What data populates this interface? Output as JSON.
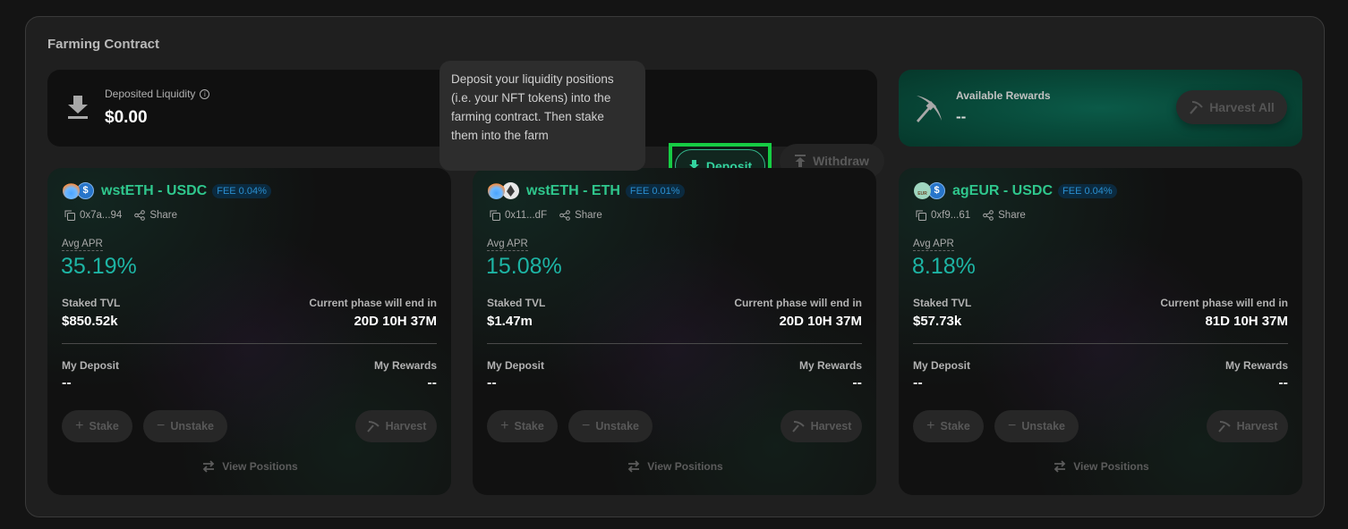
{
  "panel": {
    "title": "Farming Contract"
  },
  "liquidity": {
    "label": "Deposited Liquidity",
    "value": "$0.00",
    "icon": "download-icon",
    "info_icon": "info-icon"
  },
  "tooltip": {
    "text": "Deposit your liquidity positions (i.e. your NFT tokens) into the farming contract. Then stake them into the farm"
  },
  "actions": {
    "deposit_label": "Deposit",
    "withdraw_label": "Withdraw"
  },
  "rewards": {
    "label": "Available Rewards",
    "value": "--",
    "harvest_all_label": "Harvest All",
    "icon": "pickaxe-icon"
  },
  "colors": {
    "accent_green": "#2fc78d",
    "apr_teal": "#1db4a4",
    "fee_blue": "#2a8fd0",
    "highlight_border": "#16cc44"
  },
  "farms": [
    {
      "pair": "wstETH - USDC",
      "token_a": "wstETH",
      "token_b": "USDC",
      "fee": "FEE 0.04%",
      "address": "0x7a...94",
      "share_label": "Share",
      "apr_label": "Avg APR",
      "apr": "35.19%",
      "tvl_label": "Staked TVL",
      "tvl": "$850.52k",
      "phase_label": "Current phase will end in",
      "phase": "20D 10H 37M",
      "my_deposit_label": "My Deposit",
      "my_deposit": "--",
      "my_rewards_label": "My Rewards",
      "my_rewards": "--",
      "stake_label": "Stake",
      "unstake_label": "Unstake",
      "harvest_label": "Harvest",
      "view_positions_label": "View Positions"
    },
    {
      "pair": "wstETH - ETH",
      "token_a": "wstETH",
      "token_b": "ETH",
      "fee": "FEE 0.01%",
      "address": "0x11...dF",
      "share_label": "Share",
      "apr_label": "Avg APR",
      "apr": "15.08%",
      "tvl_label": "Staked TVL",
      "tvl": "$1.47m",
      "phase_label": "Current phase will end in",
      "phase": "20D 10H 37M",
      "my_deposit_label": "My Deposit",
      "my_deposit": "--",
      "my_rewards_label": "My Rewards",
      "my_rewards": "--",
      "stake_label": "Stake",
      "unstake_label": "Unstake",
      "harvest_label": "Harvest",
      "view_positions_label": "View Positions"
    },
    {
      "pair": "agEUR - USDC",
      "token_a": "agEUR",
      "token_b": "USDC",
      "fee": "FEE 0.04%",
      "address": "0xf9...61",
      "share_label": "Share",
      "apr_label": "Avg APR",
      "apr": "8.18%",
      "tvl_label": "Staked TVL",
      "tvl": "$57.73k",
      "phase_label": "Current phase will end in",
      "phase": "81D 10H 37M",
      "my_deposit_label": "My Deposit",
      "my_deposit": "--",
      "my_rewards_label": "My Rewards",
      "my_rewards": "--",
      "stake_label": "Stake",
      "unstake_label": "Unstake",
      "harvest_label": "Harvest",
      "view_positions_label": "View Positions"
    }
  ]
}
